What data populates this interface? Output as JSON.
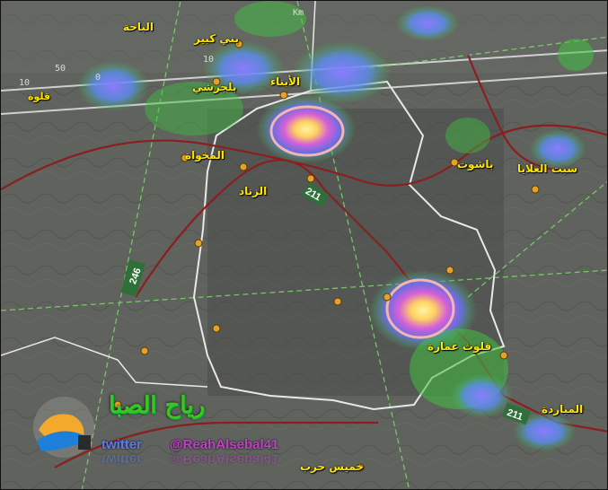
{
  "map": {
    "places": [
      {
        "id": "albaha",
        "label": "الباحة"
      },
      {
        "id": "bani-kabir",
        "label": "بني كبير"
      },
      {
        "id": "baljurashi",
        "label": "بلجرشي"
      },
      {
        "id": "alabna",
        "label": "الأبناء"
      },
      {
        "id": "qilwa",
        "label": "قلوة"
      },
      {
        "id": "almikhwah",
        "label": "المخواة"
      },
      {
        "id": "alzinad",
        "label": "الزناد"
      },
      {
        "id": "bashut",
        "label": "باشوت"
      },
      {
        "id": "sabt-alalaya",
        "label": "سبت العلايا"
      },
      {
        "id": "qunfudh-imara",
        "label": "قلوث عمارة"
      },
      {
        "id": "almuradah",
        "label": "المباردة"
      },
      {
        "id": "khamis-harb",
        "label": "خميس حرب"
      }
    ],
    "road_shields": [
      "211",
      "246",
      "211"
    ],
    "scale_labels": [
      "10",
      "50",
      "0",
      "10",
      "Km"
    ]
  },
  "branding": {
    "title": "رياح الصبا",
    "twitter": "twitter",
    "handle": "@ReahAlsebal41"
  },
  "colors": {
    "radar_green": "#3fbf3f",
    "radar_blue": "#5a6ff0",
    "radar_purple": "#c05ad8",
    "radar_core": "#ffe27a",
    "highlight_circle": "#f2b6b0",
    "label_yellow": "#ffe600"
  }
}
